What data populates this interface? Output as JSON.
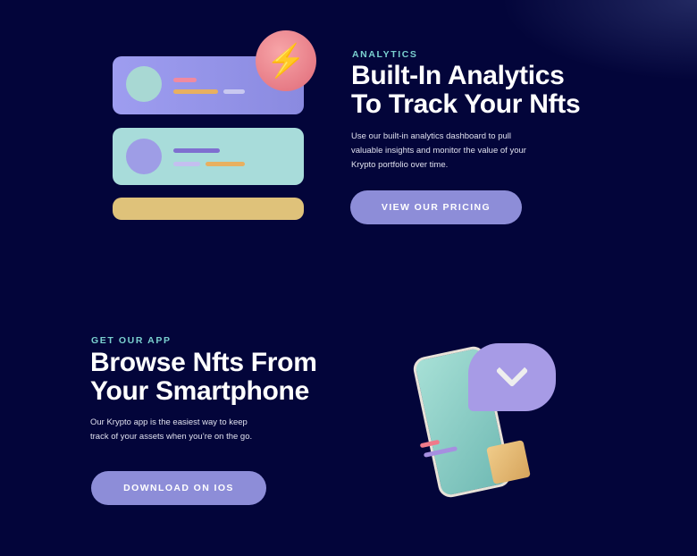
{
  "analytics": {
    "eyebrow": "ANALYTICS",
    "title_line1": "Built-In Analytics",
    "title_line2": "To Track Your Nfts",
    "description_line1": "Use our built-in analytics dashboard to pull",
    "description_line2": "valuable insights and monitor the value of your",
    "description_line3": "Krypto portfolio over time.",
    "button_label": "VIEW OUR PRICING",
    "illustration_icon": "lightning-bolt-icon"
  },
  "app": {
    "eyebrow": "GET OUR APP",
    "title_line1": "Browse Nfts From",
    "title_line2": "Your Smartphone",
    "description_line1": "Our Krypto app is the easiest way to keep",
    "description_line2": "track of your assets when you’re on the go.",
    "button_label": "DOWNLOAD ON IOS",
    "illustration_icon": "smartphone-icon"
  },
  "colors": {
    "background": "#03053a",
    "accent": "#8d8dd8",
    "eyebrow": "#7ad0cf"
  }
}
